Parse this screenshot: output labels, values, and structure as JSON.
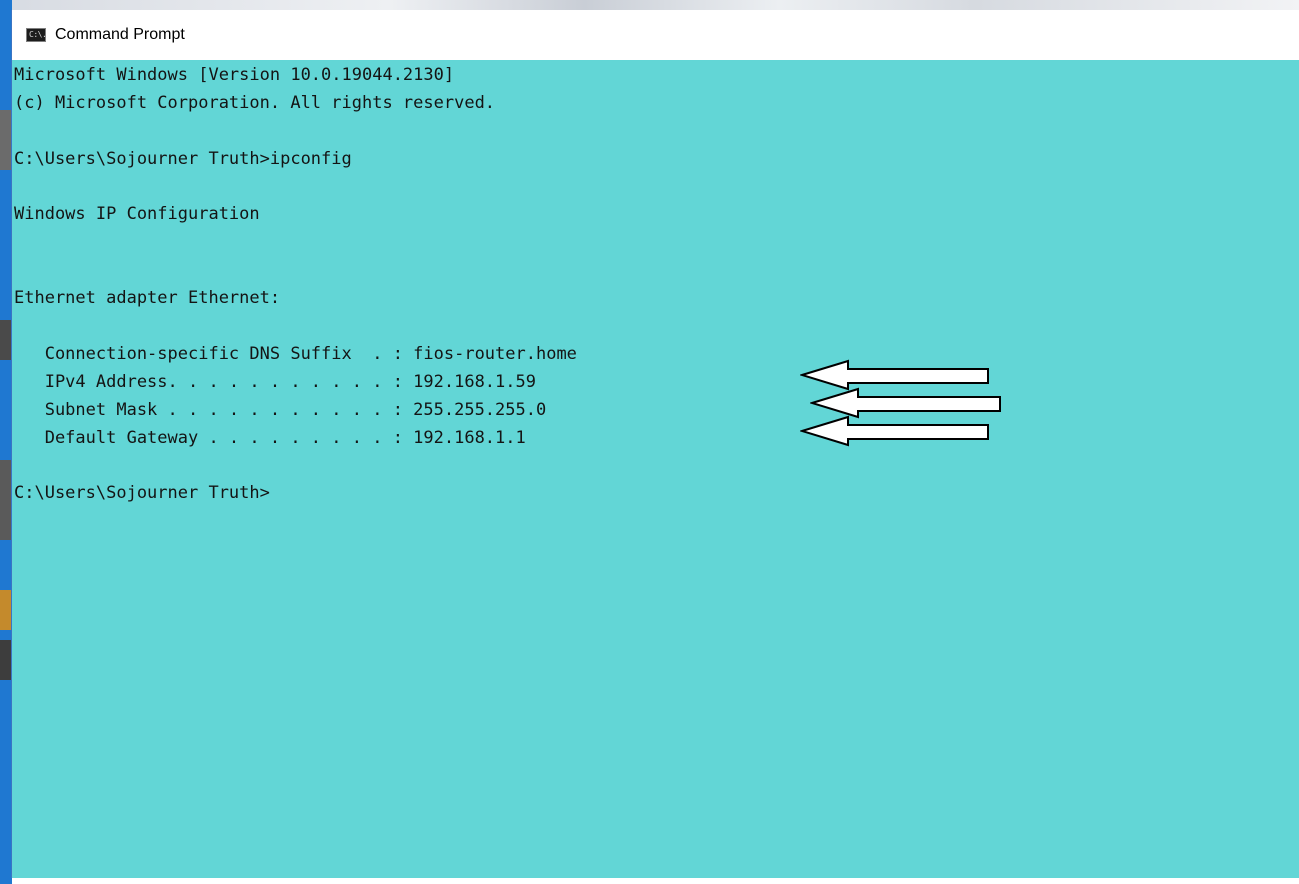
{
  "window": {
    "title": "Command Prompt",
    "icon": "console-icon",
    "icon_glyph": "C:\\."
  },
  "console": {
    "background_color": "#62d6d6",
    "text_color": "#141414",
    "lines": [
      "Microsoft Windows [Version 10.0.19044.2130]",
      "(c) Microsoft Corporation. All rights reserved.",
      "",
      "C:\\Users\\Sojourner Truth>ipconfig",
      "",
      "Windows IP Configuration",
      "",
      "",
      "Ethernet adapter Ethernet:",
      "",
      "   Connection-specific DNS Suffix  . : fios-router.home",
      "   IPv4 Address. . . . . . . . . . . : 192.168.1.59",
      "   Subnet Mask . . . . . . . . . . . : 255.255.255.0",
      "   Default Gateway . . . . . . . . . : 192.168.1.1",
      "",
      "C:\\Users\\Sojourner Truth>"
    ]
  },
  "annotations": {
    "arrow_icon": "left-arrow-icon",
    "arrow_fill": "#ffffff",
    "arrow_stroke": "#000000",
    "points_to": [
      "IPv4 Address",
      "Subnet Mask",
      "Default Gateway"
    ]
  }
}
